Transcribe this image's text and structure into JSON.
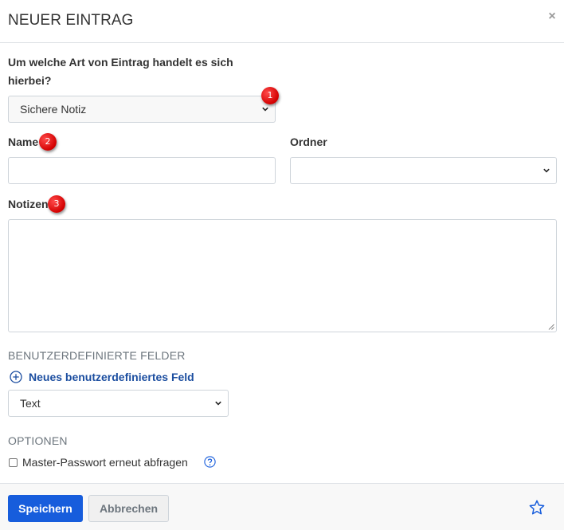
{
  "dialog": {
    "title": "NEUER EINTRAG",
    "close_symbol": "×"
  },
  "type_field": {
    "label_line1": "Um welche Art von Eintrag handelt es sich",
    "label_line2": "hierbei?",
    "selected": "Sichere Notiz"
  },
  "name_field": {
    "label": "Name",
    "value": ""
  },
  "folder_field": {
    "label": "Ordner",
    "selected": ""
  },
  "notes_field": {
    "label": "Notizen",
    "value": ""
  },
  "custom_fields": {
    "heading": "BENUTZERDEFINIERTE FELDER",
    "add_label": "Neues benutzerdefiniertes Feld",
    "type_selected": "Text"
  },
  "options": {
    "heading": "OPTIONEN",
    "reprompt_label": "Master-Passwort erneut abfragen",
    "reprompt_checked": false
  },
  "footer": {
    "save_label": "Speichern",
    "cancel_label": "Abbrechen"
  },
  "annotations": [
    "1",
    "2",
    "3"
  ],
  "colors": {
    "primary": "#175ddc",
    "link": "#1c4ea0",
    "badge": "#e00000"
  }
}
